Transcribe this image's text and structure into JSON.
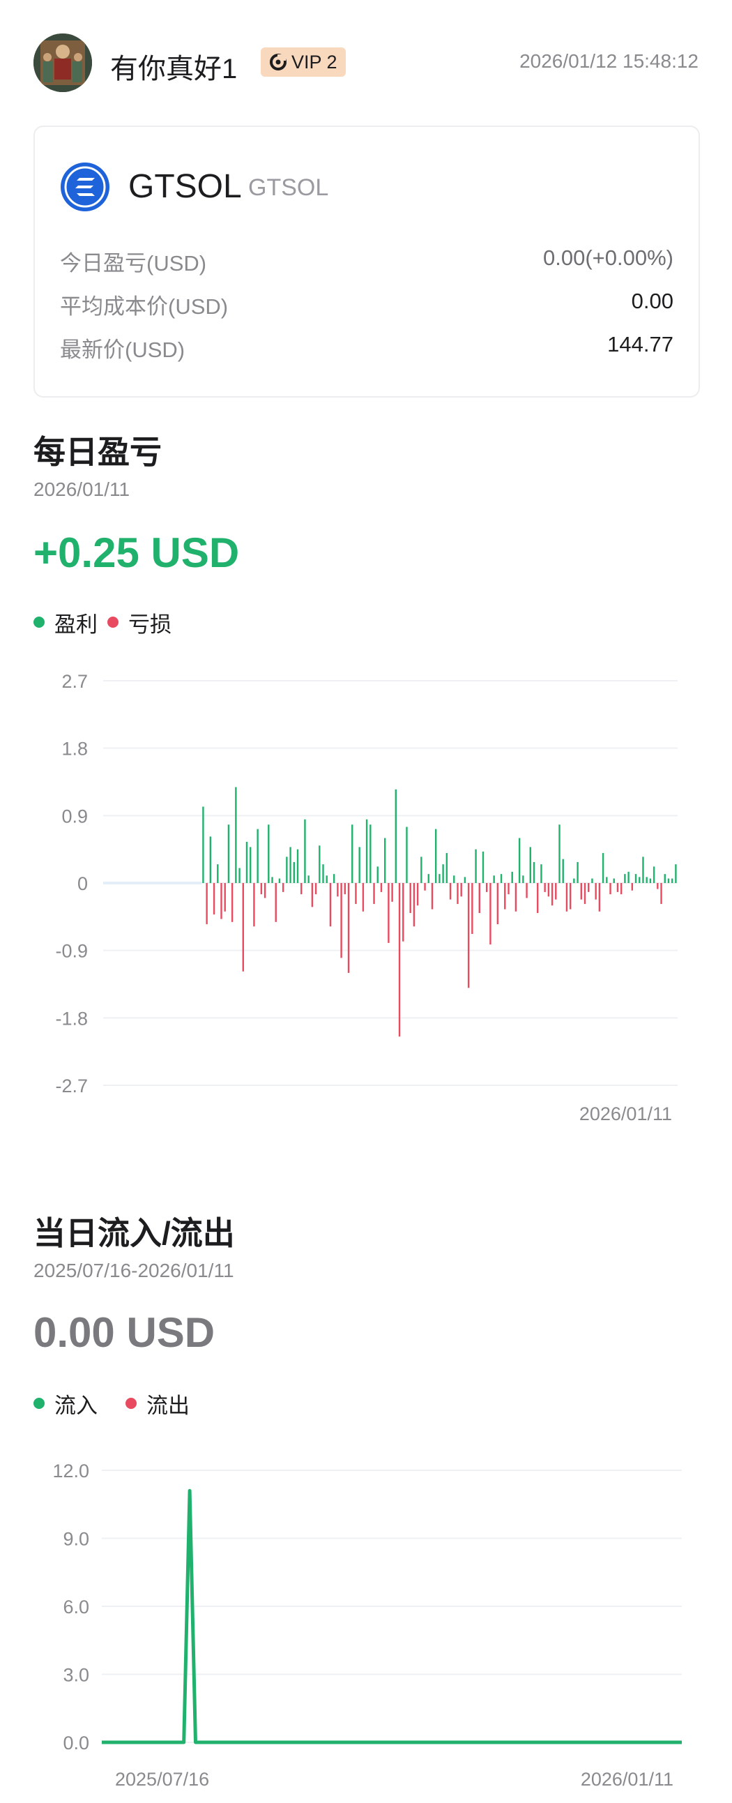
{
  "header": {
    "username": "有你真好1",
    "vip_label": "VIP 2",
    "timestamp": "2026/01/12 15:48:12"
  },
  "coin": {
    "name": "GTSOL",
    "sub": "GTSOL",
    "rows": [
      {
        "label": "今日盈亏(USD)",
        "value": "0.00(+0.00%)"
      },
      {
        "label": "平均成本价(USD)",
        "value": "0.00"
      },
      {
        "label": "最新价(USD)",
        "value": "144.77"
      }
    ]
  },
  "daily_pnl": {
    "title": "每日盈亏",
    "date": "2026/01/11",
    "amount": "+0.25 USD",
    "legend_profit": "盈利",
    "legend_loss": "亏损"
  },
  "flow": {
    "title": "当日流入/流出",
    "date_range": "2025/07/16-2026/01/11",
    "amount": "0.00 USD",
    "legend_in": "流入",
    "legend_out": "流出"
  },
  "colors": {
    "profit": "#20b26c",
    "loss": "#e84a5f",
    "grid": "#eef0f3",
    "axis_text": "#8a8a8e"
  },
  "icons": {
    "vip": "vip-badge-icon",
    "coin": "solana-logo-icon",
    "avatar": "user-avatar"
  },
  "chart_data": [
    {
      "type": "bar",
      "ylim": [
        -2.7,
        2.7
      ],
      "yticks": [
        "2.7",
        "1.8",
        "0.9",
        "0",
        "-0.9",
        "-1.8",
        "-2.7"
      ],
      "x_label_end": "2026/01/11",
      "start_offset_bars": 27,
      "values": [
        1.02,
        -0.55,
        0.62,
        -0.42,
        0.25,
        -0.48,
        -0.38,
        0.78,
        -0.52,
        1.28,
        0.2,
        -1.18,
        0.55,
        0.48,
        -0.58,
        0.72,
        -0.15,
        -0.2,
        0.78,
        0.08,
        -0.52,
        0.06,
        -0.12,
        0.35,
        0.48,
        0.28,
        0.45,
        -0.15,
        0.85,
        0.1,
        -0.32,
        -0.15,
        0.5,
        0.25,
        0.1,
        -0.58,
        0.12,
        -0.18,
        -1.0,
        -0.15,
        -1.2,
        0.78,
        -0.28,
        0.48,
        -0.38,
        0.85,
        0.78,
        -0.28,
        0.22,
        -0.12,
        0.6,
        -0.8,
        -0.25,
        1.25,
        -2.05,
        -0.78,
        0.75,
        -0.4,
        -0.58,
        -0.3,
        0.35,
        -0.1,
        0.12,
        -0.35,
        0.72,
        0.12,
        0.25,
        0.4,
        -0.22,
        0.1,
        -0.28,
        -0.18,
        0.08,
        -1.4,
        -0.68,
        0.45,
        -0.4,
        0.42,
        -0.12,
        -0.82,
        0.1,
        -0.55,
        0.12,
        -0.35,
        -0.15,
        0.15,
        -0.38,
        0.6,
        0.1,
        -0.2,
        0.48,
        0.28,
        -0.4,
        0.25,
        -0.12,
        -0.18,
        -0.3,
        -0.22,
        0.78,
        0.32,
        -0.38,
        -0.35,
        0.06,
        0.28,
        -0.22,
        -0.28,
        -0.12,
        0.06,
        -0.22,
        -0.38,
        0.4,
        0.08,
        -0.15,
        0.06,
        -0.12,
        -0.15,
        0.12,
        0.15,
        -0.1,
        0.12,
        0.08,
        0.35,
        0.08,
        0.06,
        0.22,
        -0.08,
        -0.28,
        0.12,
        0.06,
        0.06,
        0.25
      ]
    },
    {
      "type": "line",
      "ylim": [
        0,
        12
      ],
      "yticks": [
        "12.0",
        "9.0",
        "6.0",
        "3.0",
        "0.0"
      ],
      "x_labels": [
        "2025/07/16",
        "2026/01/11"
      ],
      "series": [
        {
          "color": "#20b26c",
          "values": [
            0,
            0,
            0,
            0,
            0,
            0,
            0,
            0,
            0,
            0,
            0,
            0,
            0,
            0,
            0,
            11.1,
            0,
            0,
            0,
            0,
            0,
            0,
            0,
            0,
            0,
            0,
            0,
            0,
            0,
            0,
            0,
            0,
            0,
            0,
            0,
            0,
            0,
            0,
            0,
            0,
            0,
            0,
            0,
            0,
            0,
            0,
            0,
            0,
            0,
            0,
            0,
            0,
            0,
            0,
            0,
            0,
            0,
            0,
            0,
            0,
            0,
            0,
            0,
            0,
            0,
            0,
            0,
            0,
            0,
            0,
            0,
            0,
            0,
            0,
            0,
            0,
            0,
            0,
            0,
            0,
            0,
            0,
            0,
            0,
            0,
            0,
            0,
            0,
            0,
            0,
            0,
            0,
            0,
            0,
            0,
            0,
            0,
            0,
            0,
            0
          ]
        }
      ]
    }
  ]
}
